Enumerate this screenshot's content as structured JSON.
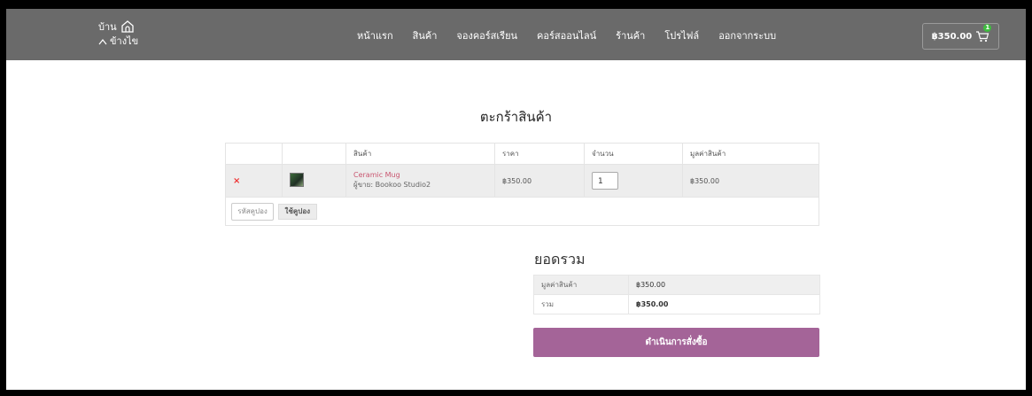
{
  "site": {
    "logo_line1": "บ้าน",
    "logo_line2": "ข้างไข"
  },
  "nav": {
    "items": [
      {
        "label": "หน้าแรก"
      },
      {
        "label": "สินค้า"
      },
      {
        "label": "จองคอร์สเรียน"
      },
      {
        "label": "คอร์สออนไลน์"
      },
      {
        "label": "ร้านค้า"
      },
      {
        "label": "โปรไฟล์"
      },
      {
        "label": "ออกจากระบบ"
      }
    ]
  },
  "cart_button": {
    "amount": "฿350.00",
    "count": "1"
  },
  "page": {
    "title": "ตะกร้าสินค้า"
  },
  "cart_table": {
    "headers": {
      "product": "สินค้า",
      "price": "ราคา",
      "quantity": "จำนวน",
      "subtotal": "มูลค่าสินค้า"
    },
    "items": [
      {
        "remove": "×",
        "name": "Ceramic Mug",
        "vendor": "ผู้ขาย: Bookoo Studio2",
        "price": "฿350.00",
        "quantity": "1",
        "subtotal": "฿350.00"
      }
    ],
    "coupon": {
      "placeholder": "รหัสคูปอง",
      "button": "ใช้คูปอง"
    }
  },
  "totals": {
    "title": "ยอดรวม",
    "subtotal_label": "มูลค่าสินค้า",
    "subtotal_value": "฿350.00",
    "total_label": "รวม",
    "total_value": "฿350.00",
    "checkout_button": "ดำเนินการสั่งซื้อ"
  },
  "colors": {
    "header_bg": "#6a6a6a",
    "accent": "#a46498",
    "product_link": "#c95670"
  }
}
